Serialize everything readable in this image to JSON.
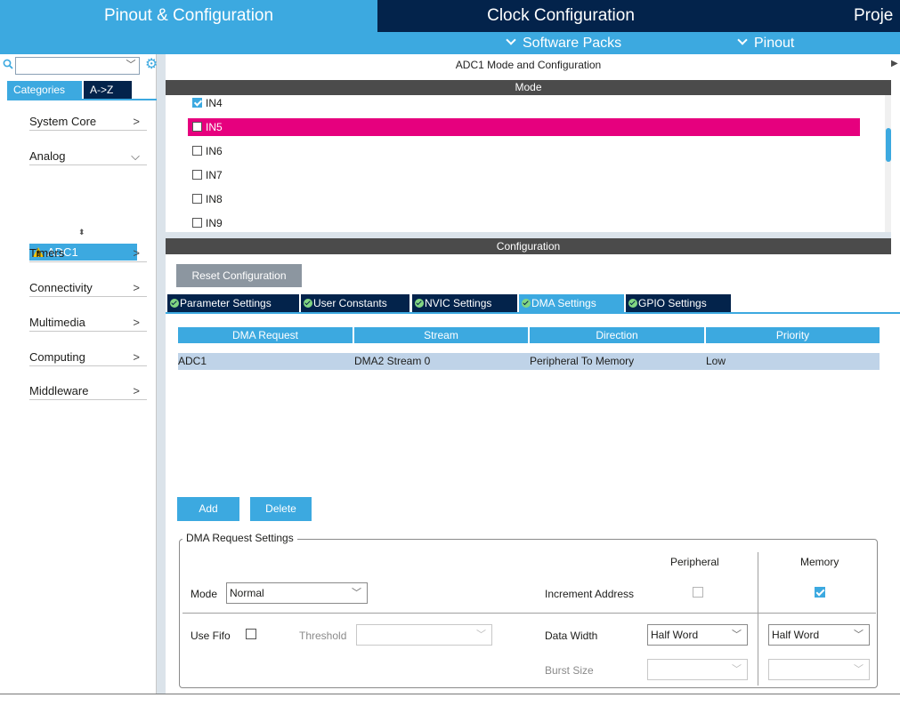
{
  "top_tabs": {
    "pinout": "Pinout & Configuration",
    "clock": "Clock Configuration",
    "project": "Proje"
  },
  "secondary_bar": {
    "software_packs": "Software Packs",
    "pinout": "Pinout"
  },
  "sidebar": {
    "search_placeholder": "",
    "tabs": {
      "categories": "Categories",
      "atoz": "A->Z"
    },
    "items": [
      {
        "label": "System Core",
        "arrow": ">"
      },
      {
        "label": "Analog",
        "arrow": "⌵"
      },
      {
        "label": "Timers",
        "arrow": ">"
      },
      {
        "label": "Connectivity",
        "arrow": ">"
      },
      {
        "label": "Multimedia",
        "arrow": ">"
      },
      {
        "label": "Computing",
        "arrow": ">"
      },
      {
        "label": "Middleware",
        "arrow": ">"
      }
    ],
    "analog_selected": "ADC1",
    "sort_glyph": "⬍"
  },
  "main": {
    "title": "ADC1 Mode and Configuration",
    "mode_header": "Mode",
    "config_header": "Configuration",
    "mode_rows": [
      {
        "label": "IN4",
        "checked": true
      },
      {
        "label": "IN5",
        "checked": false,
        "selected": true
      },
      {
        "label": "IN6",
        "checked": false
      },
      {
        "label": "IN7",
        "checked": false
      },
      {
        "label": "IN8",
        "checked": false
      },
      {
        "label": "IN9",
        "checked": false
      }
    ],
    "reset_button": "Reset Configuration",
    "config_tabs": [
      {
        "label": "Parameter Settings",
        "active": false
      },
      {
        "label": "User Constants",
        "active": false
      },
      {
        "label": "NVIC Settings",
        "active": false
      },
      {
        "label": "DMA Settings",
        "active": true
      },
      {
        "label": "GPIO Settings",
        "active": false
      }
    ]
  },
  "dma_table": {
    "columns": [
      "DMA Request",
      "Stream",
      "Direction",
      "Priority"
    ],
    "rows": [
      [
        "ADC1",
        "DMA2 Stream 0",
        "Peripheral To Memory",
        "Low"
      ]
    ],
    "add_button": "Add",
    "delete_button": "Delete"
  },
  "request_settings": {
    "legend": "DMA Request Settings",
    "peripheral_header": "Peripheral",
    "memory_header": "Memory",
    "mode_label": "Mode",
    "mode_value": "Normal",
    "increment_label": "Increment Address",
    "increment_peripheral": false,
    "increment_memory": true,
    "use_fifo_label": "Use Fifo",
    "use_fifo": false,
    "threshold_label": "Threshold",
    "threshold_value": "",
    "data_width_label": "Data Width",
    "data_width_peripheral": "Half Word",
    "data_width_memory": "Half Word",
    "burst_size_label": "Burst Size",
    "burst_size_peripheral": "",
    "burst_size_memory": ""
  },
  "colors": {
    "accent": "#3ca9e0",
    "navy": "#03234b",
    "selection_pink": "#e6007e",
    "table_row": "#bfd3e8",
    "dark_header": "#4b4b4b"
  }
}
